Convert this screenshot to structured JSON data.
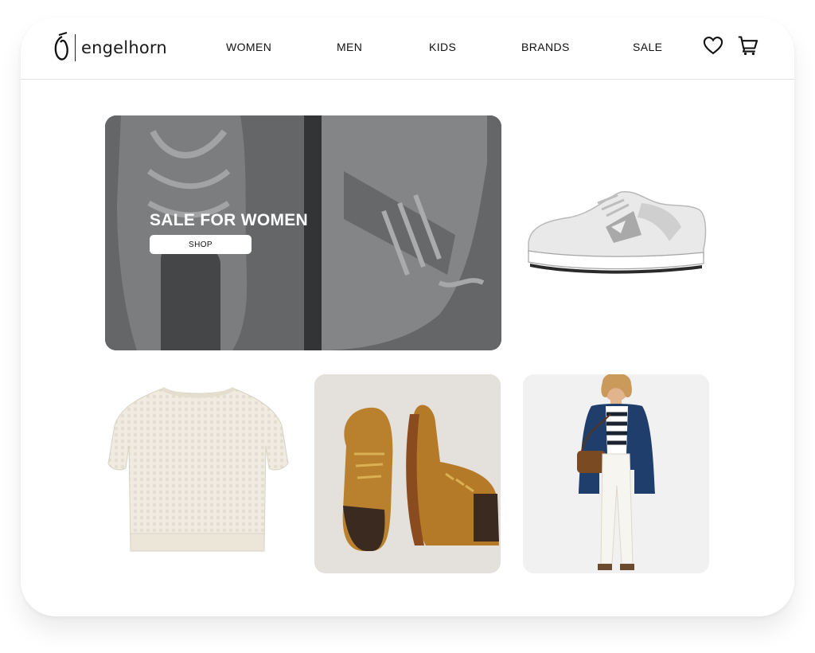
{
  "brand": {
    "name": "engelhorn"
  },
  "nav": {
    "items": [
      {
        "label": "WOMEN"
      },
      {
        "label": "MEN"
      },
      {
        "label": "KIDS"
      },
      {
        "label": "BRANDS"
      },
      {
        "label": "SALE"
      }
    ]
  },
  "header_icons": [
    "heart-icon",
    "cart-icon"
  ],
  "hero": {
    "title": "SALE FOR WOMEN",
    "button_label": "SHOP"
  },
  "products": [
    {
      "name": "sneaker-image"
    },
    {
      "name": "sweater-image"
    },
    {
      "name": "boots-image"
    },
    {
      "name": "model-coat-image"
    }
  ],
  "colors": {
    "text": "#111111",
    "hero_overlay": "#5f6163",
    "button_bg": "#ffffff"
  }
}
